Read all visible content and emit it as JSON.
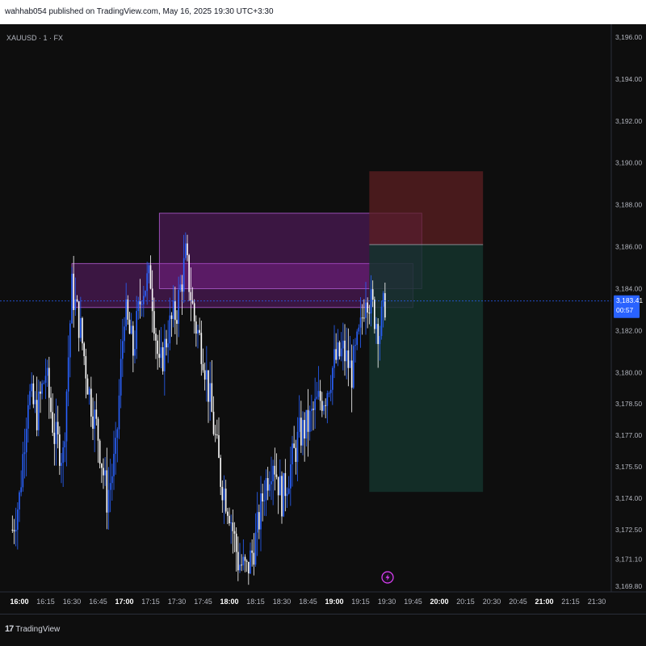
{
  "header": {
    "published_text": "wahhab054 published on TradingView.com, May 16, 2025 19:30 UTC+3:30"
  },
  "symbol": {
    "label": "XAUUSD · 1 · FX"
  },
  "footer": {
    "brand": "TradingView",
    "logo_text": "17"
  },
  "colors": {
    "background": "#0e0e0e",
    "up_candle": "#2962ff",
    "down_candle": "#ffffff",
    "current_price_badge": "#2962ff",
    "order_block_fill": "#9c27b0",
    "stop_zone": "#5c1f22",
    "target_zone": "#14332c"
  },
  "chart_data": {
    "type": "candlestick",
    "symbol": "XAUUSD",
    "interval": "1",
    "x_tick_labels": [
      "16:00",
      "16:15",
      "16:30",
      "16:45",
      "17:00",
      "17:15",
      "17:30",
      "17:45",
      "18:00",
      "18:15",
      "18:30",
      "18:45",
      "19:00",
      "19:15",
      "19:30",
      "19:45",
      "20:00",
      "20:15",
      "20:30",
      "20:45",
      "21:00",
      "21:15",
      "21:30"
    ],
    "x_tick_bold": [
      "16:00",
      "17:00",
      "18:00",
      "19:00",
      "20:00",
      "21:00"
    ],
    "y_tick_labels": [
      "3,196.00",
      "3,194.00",
      "3,192.00",
      "3,190.00",
      "3,188.00",
      "3,186.00",
      "3,184.00",
      "3,182.00",
      "3,180.00",
      "3,178.50",
      "3,177.00",
      "3,175.50",
      "3,174.00",
      "3,172.50",
      "3,171.10",
      "3,169.80"
    ],
    "y_tick_values": [
      3196.0,
      3194.0,
      3192.0,
      3190.0,
      3188.0,
      3186.0,
      3184.0,
      3182.0,
      3180.0,
      3178.5,
      3177.0,
      3175.5,
      3174.0,
      3172.5,
      3171.1,
      3169.8
    ],
    "current_price": {
      "value": 3183.41,
      "label": "3,183.41",
      "countdown": "00:57"
    },
    "close_path": [
      {
        "t": "15:56",
        "p": 3172.5
      },
      {
        "t": "16:00",
        "p": 3174.0
      },
      {
        "t": "16:05",
        "p": 3179.0
      },
      {
        "t": "16:10",
        "p": 3178.0
      },
      {
        "t": "16:15",
        "p": 3180.0
      },
      {
        "t": "16:20",
        "p": 3177.0
      },
      {
        "t": "16:25",
        "p": 3176.0
      },
      {
        "t": "16:30",
        "p": 3184.0
      },
      {
        "t": "16:35",
        "p": 3182.0
      },
      {
        "t": "16:40",
        "p": 3179.0
      },
      {
        "t": "16:45",
        "p": 3177.0
      },
      {
        "t": "16:50",
        "p": 3174.0
      },
      {
        "t": "16:55",
        "p": 3176.0
      },
      {
        "t": "17:00",
        "p": 3183.0
      },
      {
        "t": "17:05",
        "p": 3181.0
      },
      {
        "t": "17:10",
        "p": 3184.0
      },
      {
        "t": "17:15",
        "p": 3184.5
      },
      {
        "t": "17:20",
        "p": 3180.0
      },
      {
        "t": "17:25",
        "p": 3182.0
      },
      {
        "t": "17:30",
        "p": 3183.0
      },
      {
        "t": "17:35",
        "p": 3185.5
      },
      {
        "t": "17:40",
        "p": 3182.5
      },
      {
        "t": "17:45",
        "p": 3181.0
      },
      {
        "t": "17:50",
        "p": 3178.0
      },
      {
        "t": "17:55",
        "p": 3175.0
      },
      {
        "t": "18:00",
        "p": 3173.5
      },
      {
        "t": "18:05",
        "p": 3171.0
      },
      {
        "t": "18:10",
        "p": 3170.5
      },
      {
        "t": "18:15",
        "p": 3172.0
      },
      {
        "t": "18:20",
        "p": 3174.5
      },
      {
        "t": "18:25",
        "p": 3176.0
      },
      {
        "t": "18:30",
        "p": 3174.0
      },
      {
        "t": "18:35",
        "p": 3175.5
      },
      {
        "t": "18:40",
        "p": 3177.0
      },
      {
        "t": "18:45",
        "p": 3177.5
      },
      {
        "t": "18:50",
        "p": 3178.5
      },
      {
        "t": "18:55",
        "p": 3179.0
      },
      {
        "t": "19:00",
        "p": 3180.5
      },
      {
        "t": "19:05",
        "p": 3181.0
      },
      {
        "t": "19:10",
        "p": 3180.0
      },
      {
        "t": "19:15",
        "p": 3182.0
      },
      {
        "t": "19:18",
        "p": 3184.0
      },
      {
        "t": "19:22",
        "p": 3183.0
      },
      {
        "t": "19:26",
        "p": 3182.0
      },
      {
        "t": "19:29",
        "p": 3183.4
      }
    ],
    "zones": [
      {
        "kind": "order_block",
        "x_start": "16:30",
        "x_end": "19:45",
        "y_top": 3185.2,
        "y_bottom": 3183.1
      },
      {
        "kind": "order_block",
        "x_start": "17:20",
        "x_end": "19:50",
        "y_top": 3187.6,
        "y_bottom": 3184.0
      },
      {
        "kind": "stop_loss",
        "x_start": "19:20",
        "x_end": "20:25",
        "y_top": 3189.6,
        "y_bottom": 3186.1
      },
      {
        "kind": "take_profit",
        "x_start": "19:20",
        "x_end": "20:25",
        "y_top": 3186.1,
        "y_bottom": 3174.3
      }
    ]
  }
}
